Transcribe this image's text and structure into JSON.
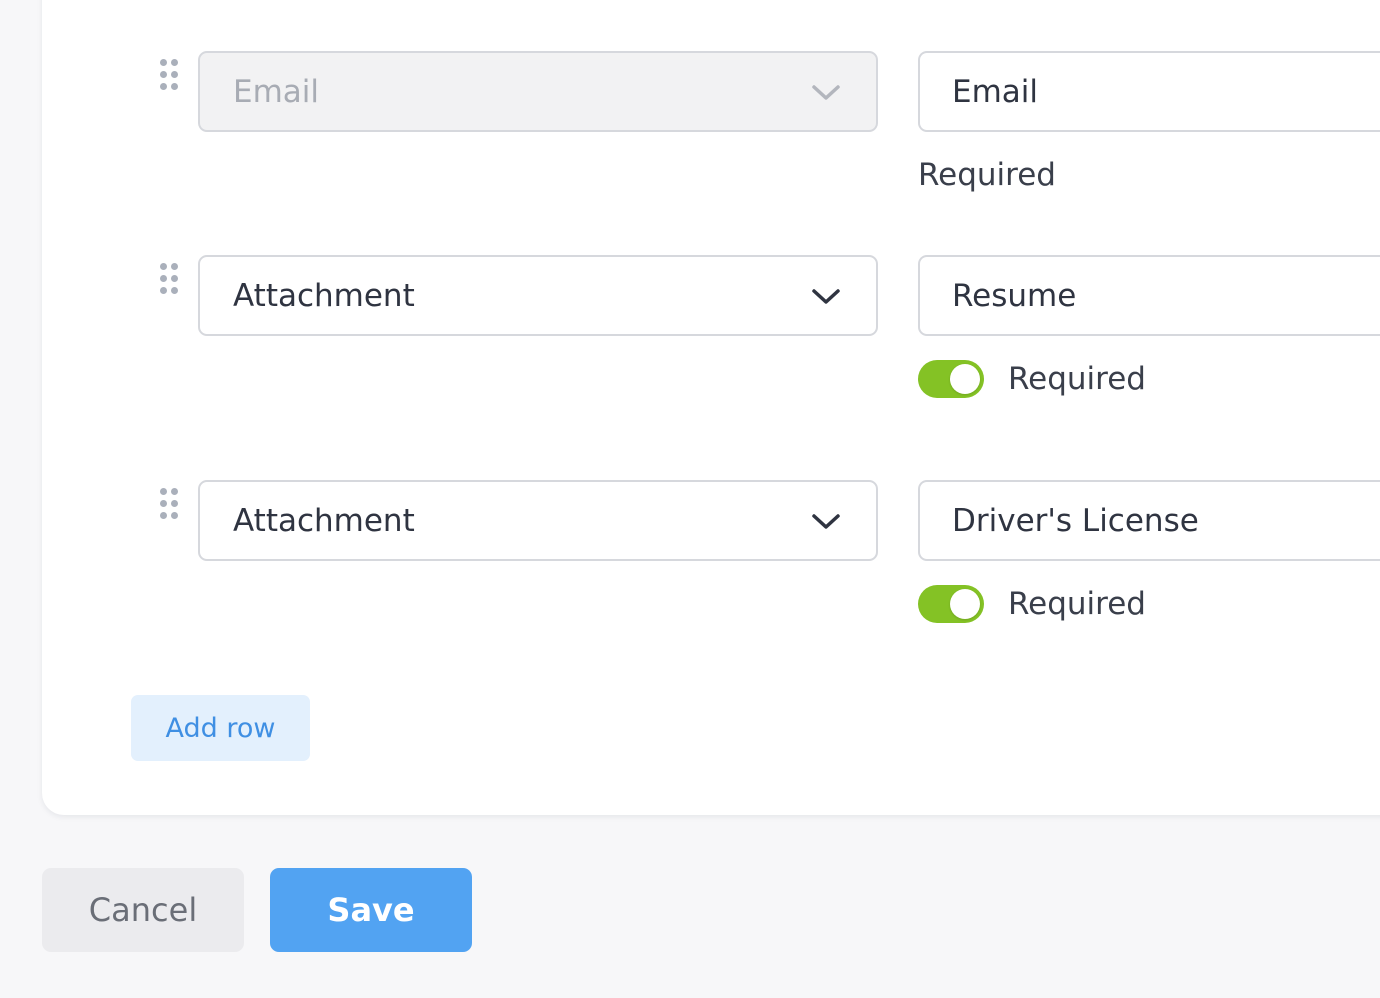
{
  "colors": {
    "page_bg": "#f7f7f9",
    "toggle_on": "#84c225",
    "add_row_bg": "#e3f0fd",
    "add_row_text": "#3f8fe3",
    "cancel_bg": "#ebebee",
    "cancel_text": "#6a6e77",
    "save_bg": "#52a3f2",
    "save_text": "#ffffff"
  },
  "rows": [
    {
      "field_type": "Email",
      "field_type_disabled": true,
      "label": "Email",
      "required_text": "Required",
      "required_toggle": null
    },
    {
      "field_type": "Attachment",
      "field_type_disabled": false,
      "label": "Resume",
      "required_text": "Required",
      "required_toggle": true
    },
    {
      "field_type": "Attachment",
      "field_type_disabled": false,
      "label": "Driver's License",
      "required_text": "Required",
      "required_toggle": true
    }
  ],
  "add_row_label": "Add row",
  "actions": {
    "cancel_label": "Cancel",
    "save_label": "Save"
  },
  "icons": {
    "drag": "drag-handle-icon",
    "dropdown": "chevron-down-icon"
  }
}
